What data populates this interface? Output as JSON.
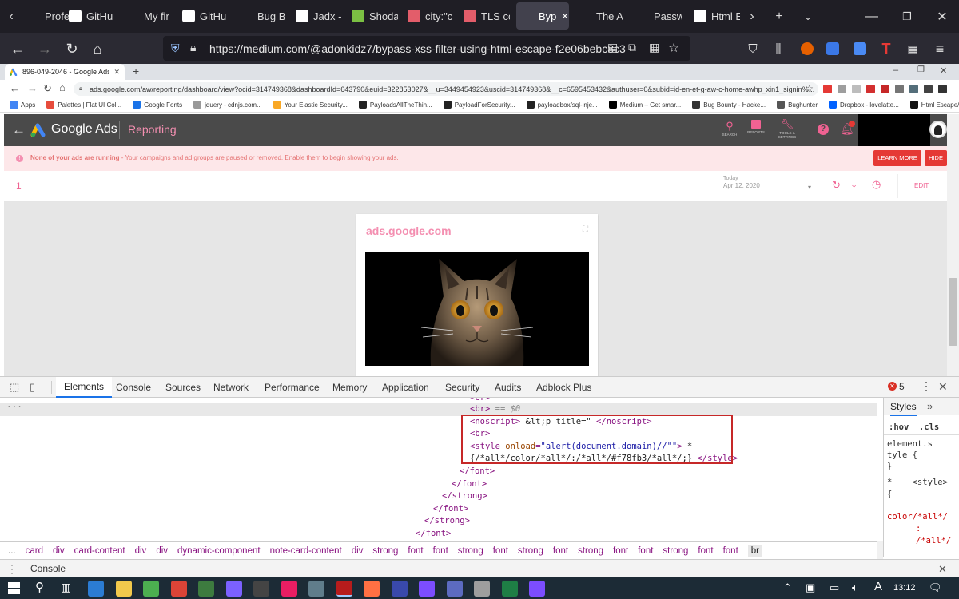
{
  "firefox": {
    "tabs": [
      {
        "label": "Profes",
        "color": "#2b2a33"
      },
      {
        "label": "GitHu",
        "color": "#ffffff"
      },
      {
        "label": "My fir",
        "color": "#2b2a33"
      },
      {
        "label": "GitHu",
        "color": "#ffffff"
      },
      {
        "label": "Bug B",
        "color": "#2b2a33"
      },
      {
        "label": "Jadx -",
        "color": "#ffffff"
      },
      {
        "label": "Shoda",
        "color": "#7bc043"
      },
      {
        "label": "city:\"c",
        "color": "#e35d6a"
      },
      {
        "label": "TLS cc",
        "color": "#e35d6a"
      },
      {
        "label": "Byp",
        "color": "#2b2a33"
      },
      {
        "label": "The A",
        "color": "#2b2a33"
      },
      {
        "label": "Passw",
        "color": "#2b2a33"
      },
      {
        "label": "Html E",
        "color": "#ffffff"
      }
    ],
    "url": "https://medium.com/@adonkidz7/bypass-xss-filter-using-html-escape-f2e06bebc8c3"
  },
  "chrome": {
    "tab_title": "896-049-2046 - Google Ads",
    "url": "ads.google.com/aw/reporting/dashboard/view?ocid=314749368&dashboardId=643790&euid=322853027&__u=3449454923&uscid=314749368&__c=6595453432&authuser=0&subid=id-en-et-g-aw-c-home-awhp_xin1_signin%...",
    "bookmarks": [
      {
        "label": "Apps",
        "color": "#4285f4"
      },
      {
        "label": "Palettes | Flat UI Col...",
        "color": "#e74c3c"
      },
      {
        "label": "Google Fonts",
        "color": "#1a73e8"
      },
      {
        "label": "jquery - cdnjs.com...",
        "color": "#999999"
      },
      {
        "label": "Your Elastic Security...",
        "color": "#f9a825"
      },
      {
        "label": "PayloadsAllTheThin...",
        "color": "#222222"
      },
      {
        "label": "PayloadForSecurity...",
        "color": "#222222"
      },
      {
        "label": "payloadbox/sql-inje...",
        "color": "#222222"
      },
      {
        "label": "Medium – Get smar...",
        "color": "#000000"
      },
      {
        "label": "Bug Bounty - Hacke...",
        "color": "#333333"
      },
      {
        "label": "Bughunter",
        "color": "#555555"
      },
      {
        "label": "Dropbox - lovelatte...",
        "color": "#0061ff"
      },
      {
        "label": "Html Escape/Unesc...",
        "color": "#111111"
      }
    ]
  },
  "ads": {
    "brand": "Google Ads",
    "section": "Reporting",
    "header_buttons": [
      {
        "label": "SEARCH"
      },
      {
        "label": "REPORTS"
      },
      {
        "label": "TOOLS & SETTINGS"
      }
    ],
    "banner_title": "None of your ads are running",
    "banner_text": " - Your campaigns and ad groups are paused or removed. Enable them to begin showing your ads.",
    "learn_more": "LEARN MORE",
    "hide": "HIDE",
    "report_name": "1",
    "date_label": "Today",
    "date_value": "Apr 12, 2020",
    "edit": "EDIT",
    "card_title": "ads.google.com"
  },
  "devtools": {
    "tabs": [
      "Elements",
      "Console",
      "Sources",
      "Network",
      "Performance",
      "Memory",
      "Application",
      "Security",
      "Audits",
      "Adblock Plus"
    ],
    "error_count": "5",
    "dom_lines": [
      {
        "indent": 588,
        "html": "<span class='tag'>&lt;br&gt;</span><span class='cmt'> == $0</span>"
      },
      {
        "indent": 588,
        "html": "<span class='tag'>&lt;noscript&gt;</span><span class='txt'> &amp;lt;p title=\" </span><span class='tag'>&lt;/noscript&gt;</span>"
      },
      {
        "indent": 588,
        "html": "<span class='tag'>&lt;br&gt;</span>"
      },
      {
        "indent": 588,
        "html": "<span class='tag'>&lt;style </span><span class='attr'>onload</span><span class='tag'>=</span><span class='val'>\"alert(document.domain)//\"\"</span><span class='tag'>&gt;</span><span class='txt'> *</span>"
      },
      {
        "indent": 588,
        "html": "<span class='txt'>{/*all*/color/*all*/:/*all*/#f78fb3/*all*/;} </span><span class='tag'>&lt;/style&gt;</span>"
      },
      {
        "indent": 575,
        "html": "<span class='tag'>&lt;/font&gt;</span>"
      },
      {
        "indent": 565,
        "html": "<span class='tag'>&lt;/font&gt;</span>"
      },
      {
        "indent": 553,
        "html": "<span class='tag'>&lt;/strong&gt;</span>"
      },
      {
        "indent": 542,
        "html": "<span class='tag'>&lt;/font&gt;</span>"
      },
      {
        "indent": 531,
        "html": "<span class='tag'>&lt;/strong&gt;</span>"
      },
      {
        "indent": 520,
        "html": "<span class='tag'>&lt;/font&gt;</span>"
      }
    ],
    "styles_title": "Styles",
    "styles_filter": ":hov  .cls",
    "style_lines": [
      "element.s",
      "tyle {",
      "}",
      "*    <style>",
      "{",
      "color/*all*/",
      ":",
      "/*all*/"
    ],
    "breadcrumbs": [
      "...",
      "card",
      "div",
      "card-content",
      "div",
      "div",
      "dynamic-component",
      "note-card-content",
      "div",
      "strong",
      "font",
      "font",
      "strong",
      "font",
      "strong",
      "font",
      "strong",
      "font",
      "font",
      "strong",
      "font",
      "font",
      "br"
    ],
    "drawer_label": "Console"
  },
  "taskbar": {
    "time": "13:12",
    "apps": [
      "#2b7cd3",
      "#f2c94c",
      "#4caf50",
      "#db4437",
      "#3d7b3f",
      "#7b61ff",
      "#444444",
      "#e91e63",
      "#607d8b",
      "#b71c1c",
      "#ff7043",
      "#3949ab",
      "#7c4dff",
      "#5c6bc0",
      "#9e9e9e",
      "#1e7e45",
      "#7c4dff"
    ]
  }
}
